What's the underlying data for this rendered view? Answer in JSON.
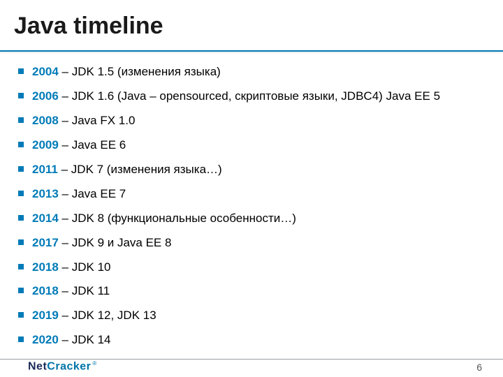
{
  "title": "Java timeline",
  "items": [
    {
      "year": "2004",
      "desc": " – JDK 1.5 (изменения языка)"
    },
    {
      "year": "2006",
      "desc": " – JDK 1.6 (Java – opensourced, скриптовые языки, JDBC4) Java EE 5"
    },
    {
      "year": "2008",
      "desc": " – Java FX 1.0"
    },
    {
      "year": "2009",
      "desc": " – Java EE 6"
    },
    {
      "year": "2011",
      "desc": " – JDK 7 (изменения языка…)"
    },
    {
      "year": "2013",
      "desc": " – Java EE 7"
    },
    {
      "year": "2014",
      "desc": " – JDK 8 (функциональные особенности…)"
    },
    {
      "year": "2017",
      "desc": " – JDK 9 и Java EE 8"
    },
    {
      "year": "2018",
      "desc": " – JDK 10"
    },
    {
      "year": "2018",
      "desc": " – JDK 11"
    },
    {
      "year": "2019",
      "desc": " – JDK 12, JDK 13"
    },
    {
      "year": "2020",
      "desc": " – JDK 14"
    }
  ],
  "logo": {
    "part1": "Net",
    "part2": "Cracker",
    "reg": "®"
  },
  "page_number": "6"
}
